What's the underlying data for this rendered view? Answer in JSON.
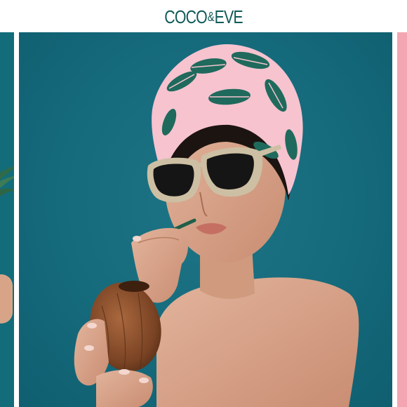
{
  "header": {
    "logo_left": "COCO",
    "logo_amp": "&",
    "logo_right": "EVE",
    "brand_color": "#0f5a57"
  },
  "carousel": {
    "slides": [
      {
        "position": "previous",
        "background": "#136c7a"
      },
      {
        "position": "current",
        "background": "#156a7b"
      },
      {
        "position": "next",
        "background": "#f3a6b2"
      }
    ]
  }
}
